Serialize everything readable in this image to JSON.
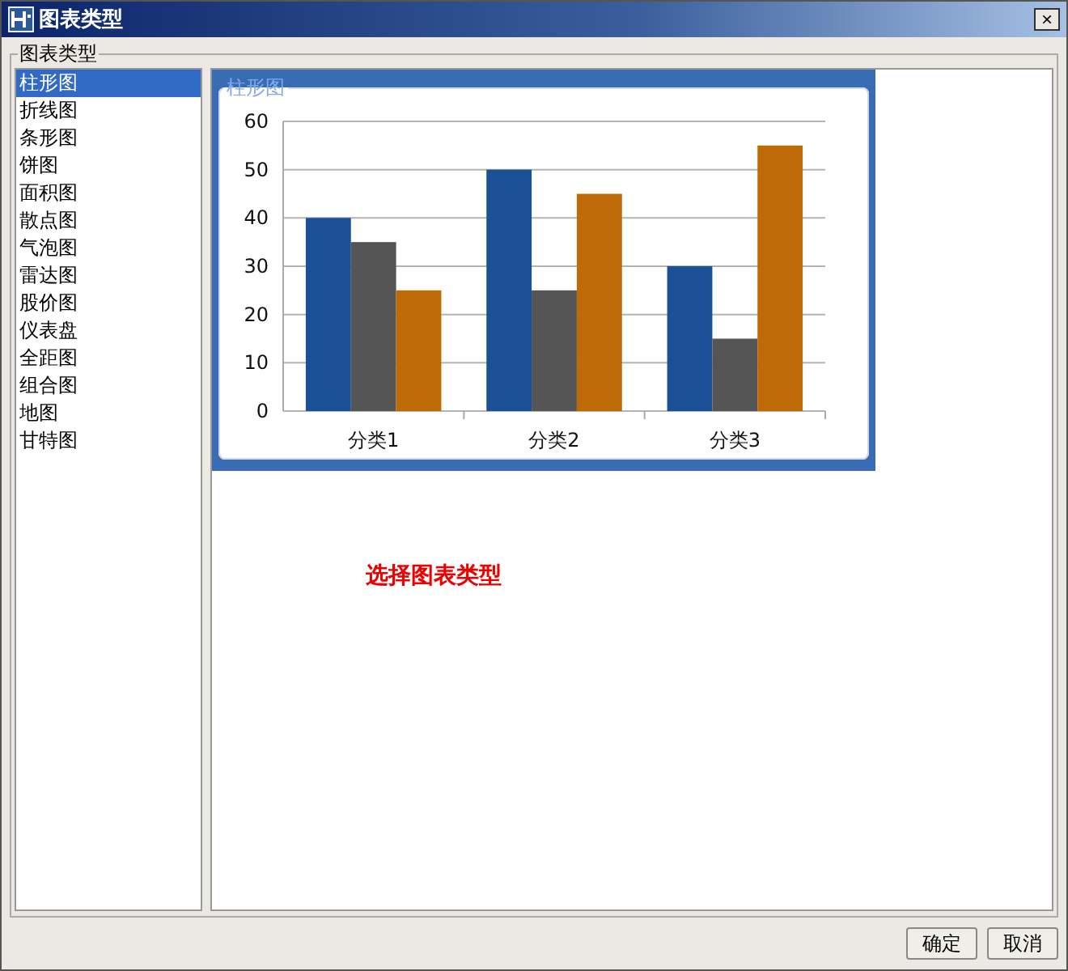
{
  "window": {
    "title": "图表类型",
    "close": "×"
  },
  "group": {
    "label": "图表类型"
  },
  "types": [
    {
      "label": "柱形图",
      "selected": true
    },
    {
      "label": "折线图",
      "selected": false
    },
    {
      "label": "条形图",
      "selected": false
    },
    {
      "label": "饼图",
      "selected": false
    },
    {
      "label": "面积图",
      "selected": false
    },
    {
      "label": "散点图",
      "selected": false
    },
    {
      "label": "气泡图",
      "selected": false
    },
    {
      "label": "雷达图",
      "selected": false
    },
    {
      "label": "股价图",
      "selected": false
    },
    {
      "label": "仪表盘",
      "selected": false
    },
    {
      "label": "全距图",
      "selected": false
    },
    {
      "label": "组合图",
      "selected": false
    },
    {
      "label": "地图",
      "selected": false
    },
    {
      "label": "甘特图",
      "selected": false
    }
  ],
  "gallery": [
    {
      "label": "柱形图",
      "selected": true,
      "chart_data": {
        "type": "bar",
        "categories": [
          "分类1",
          "分类2",
          "分类3"
        ],
        "ylim": [
          0,
          60
        ],
        "grid": true,
        "yticks": [
          0,
          10,
          20,
          30,
          40,
          50,
          60
        ],
        "series": [
          {
            "color": "#1a5096",
            "values": [
              40,
              50,
              30
            ]
          },
          {
            "color": "#555555",
            "values": [
              35,
              25,
              15
            ]
          },
          {
            "color": "#bd6a07",
            "values": [
              25,
              45,
              55
            ]
          }
        ]
      }
    }
  ],
  "message": "选择图表类型",
  "buttons": [
    "确定",
    "取消"
  ]
}
